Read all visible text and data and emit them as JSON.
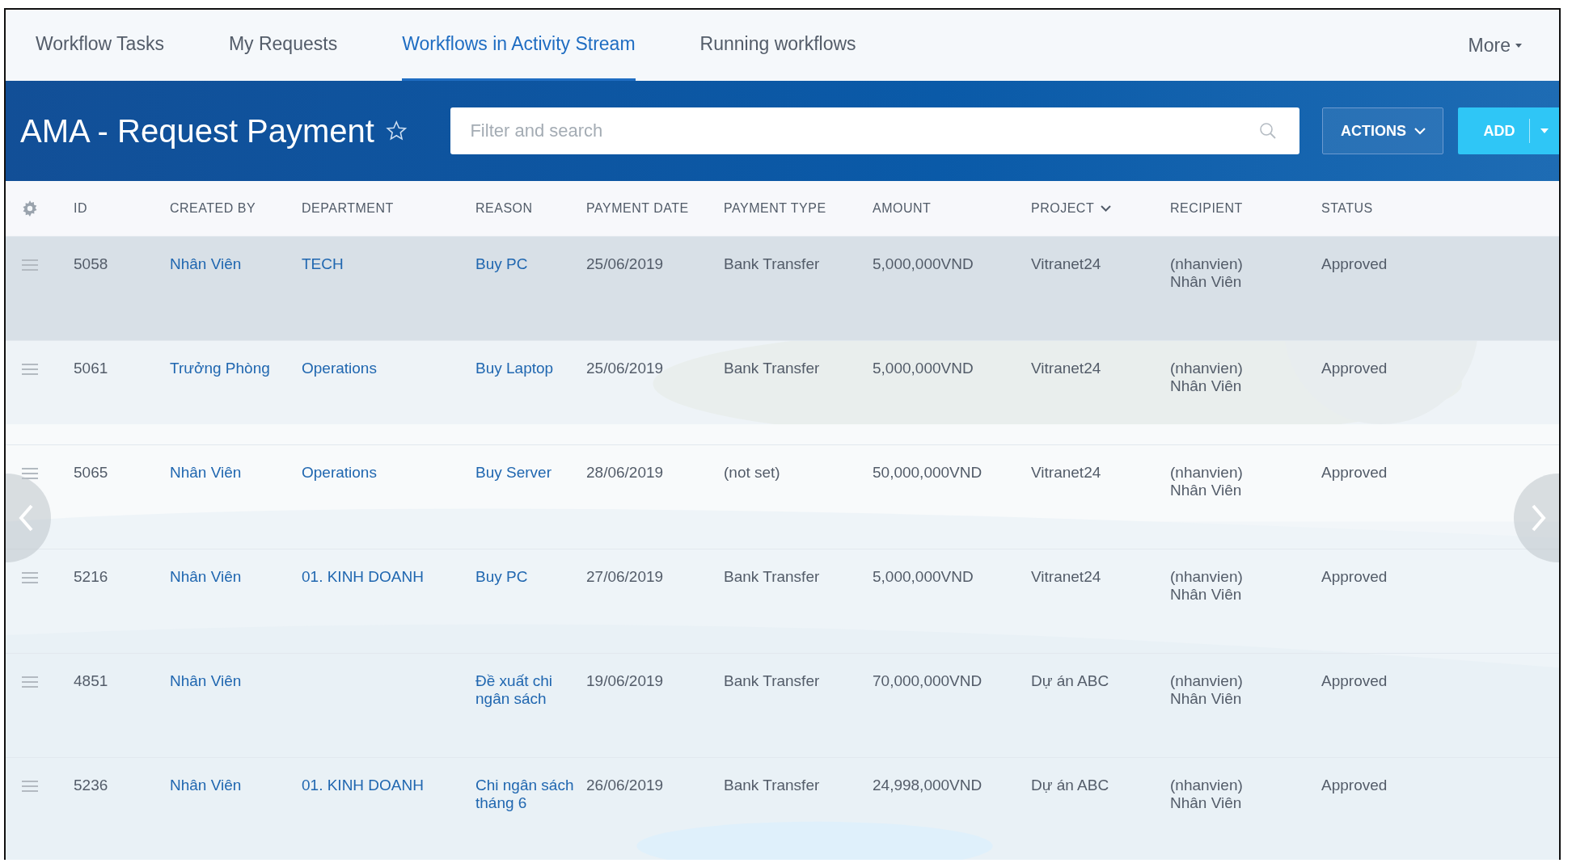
{
  "tabs": [
    {
      "label": "Workflow Tasks",
      "selected": false
    },
    {
      "label": "My Requests",
      "selected": false
    },
    {
      "label": "Workflows in Activity Stream",
      "selected": true
    },
    {
      "label": "Running workflows",
      "selected": false
    }
  ],
  "more": {
    "label": "More"
  },
  "header": {
    "title": "AMA - Request Payment",
    "starred": false,
    "search": {
      "placeholder": "Filter and search"
    },
    "actions": "ACTIONS",
    "add": "ADD"
  },
  "columns": [
    {
      "label": "ID",
      "kind": "text",
      "menu": false
    },
    {
      "label": "CREATED BY",
      "kind": "link",
      "menu": false
    },
    {
      "label": "DEPARTMENT",
      "kind": "link",
      "menu": false
    },
    {
      "label": "REASON",
      "kind": "link",
      "menu": false
    },
    {
      "label": "PAYMENT DATE",
      "kind": "text",
      "menu": false
    },
    {
      "label": "PAYMENT TYPE",
      "kind": "text",
      "menu": false
    },
    {
      "label": "AMOUNT",
      "kind": "text",
      "menu": false
    },
    {
      "label": "PROJECT",
      "kind": "text",
      "menu": true
    },
    {
      "label": "RECIPIENT",
      "kind": "lines",
      "menu": false
    },
    {
      "label": "STATUS",
      "kind": "text",
      "menu": false
    }
  ],
  "rows": [
    {
      "selected": true,
      "cells": [
        "5058",
        "Nhân Viên",
        "TECH",
        "Buy PC",
        "25/06/2019",
        "Bank Transfer",
        "5,000,000VND",
        "Vitranet24",
        [
          "(nhanvien)",
          "Nhân Viên"
        ],
        "Approved"
      ]
    },
    {
      "selected": false,
      "cells": [
        "5061",
        "Trưởng Phòng",
        "Operations",
        "Buy Laptop",
        "25/06/2019",
        "Bank Transfer",
        "5,000,000VND",
        "Vitranet24",
        [
          "(nhanvien)",
          "Nhân Viên"
        ],
        "Approved"
      ]
    },
    {
      "selected": false,
      "cells": [
        "5065",
        "Nhân Viên",
        "Operations",
        "Buy Server",
        "28/06/2019",
        "(not set)",
        "50,000,000VND",
        "Vitranet24",
        [
          "(nhanvien)",
          "Nhân Viên"
        ],
        "Approved"
      ]
    },
    {
      "selected": false,
      "cells": [
        "5216",
        "Nhân Viên",
        "01. KINH DOANH",
        "Buy PC",
        "27/06/2019",
        "Bank Transfer",
        "5,000,000VND",
        "Vitranet24",
        [
          "(nhanvien)",
          "Nhân Viên"
        ],
        "Approved"
      ]
    },
    {
      "selected": false,
      "cells": [
        "4851",
        "Nhân Viên",
        null,
        "Đề xuất chi ngân sách",
        "19/06/2019",
        "Bank Transfer",
        "70,000,000VND",
        "Dự án ABC",
        [
          "(nhanvien)",
          "Nhân Viên"
        ],
        "Approved"
      ]
    },
    {
      "selected": false,
      "cells": [
        "5236",
        "Nhân Viên",
        "01. KINH DOANH",
        "Chi ngân sách tháng 6",
        "26/06/2019",
        "Bank Transfer",
        "24,998,000VND",
        "Dự án ABC",
        [
          "(nhanvien)",
          "Nhân Viên"
        ],
        "Approved"
      ]
    }
  ]
}
